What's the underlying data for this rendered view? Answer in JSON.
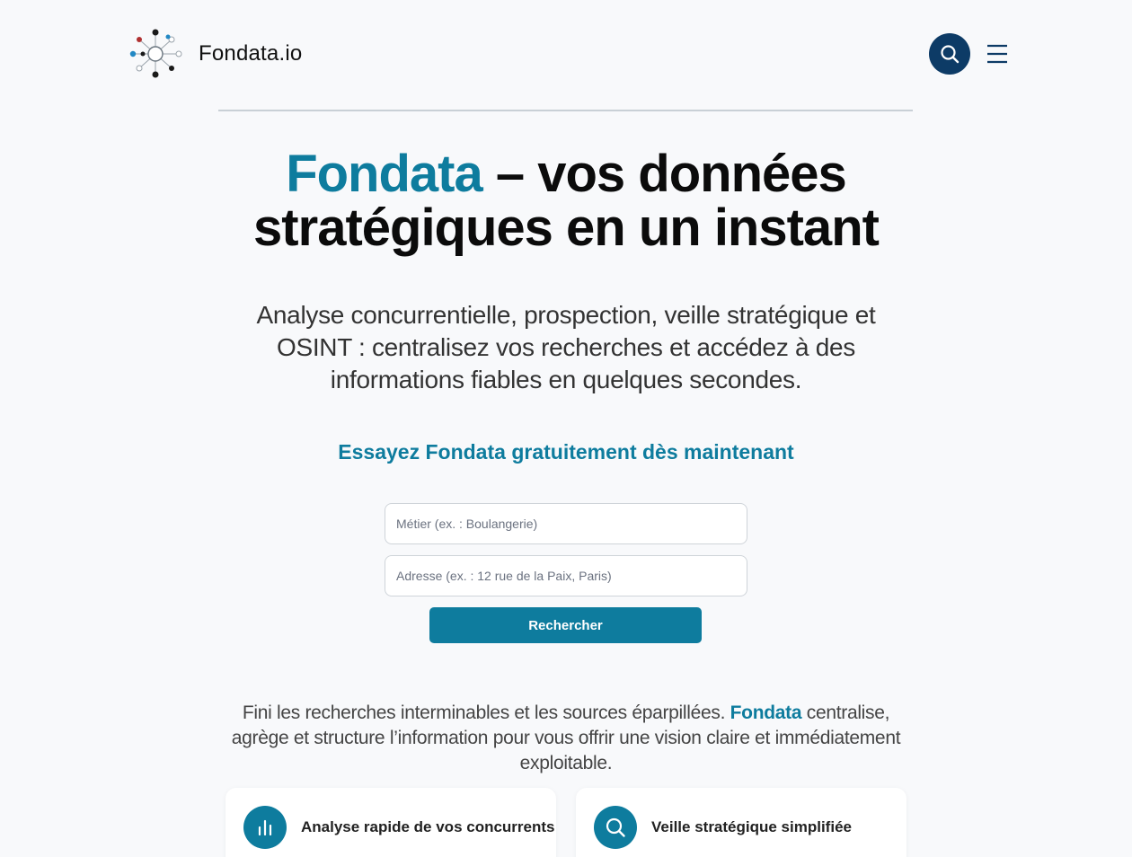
{
  "header": {
    "logo_text": "Fondata.io"
  },
  "hero": {
    "title_brand": "Fondata",
    "title_rest_line1": " – vos données",
    "title_line2": "stratégiques en un instant",
    "subtitle": "Analyse concurrentielle, prospection, veille stratégique et OSINT : centralisez vos recherches et accédez à des informations fiables en quelques secondes."
  },
  "form": {
    "cta": "Essayez Fondata gratuitement dès maintenant",
    "job_placeholder": "Métier (ex. : Boulangerie)",
    "address_placeholder": "Adresse (ex. : 12 rue de la Paix, Paris)",
    "submit_label": "Rechercher"
  },
  "description": {
    "before": "Fini les recherches interminables et les sources éparpillées. ",
    "brand": "Fondata",
    "after": " centralise, agrège et structure l’information pour vous offrir une vision claire et immédiatement exploitable."
  },
  "cards": [
    {
      "title": "Analyse rapide de vos concurrents",
      "icon": "bar-chart-icon"
    },
    {
      "title": "Veille stratégique simplifiée",
      "icon": "search-icon"
    }
  ],
  "colors": {
    "brand": "#0e7c9e",
    "navy": "#0d3b66",
    "background": "#f8f9fb"
  }
}
